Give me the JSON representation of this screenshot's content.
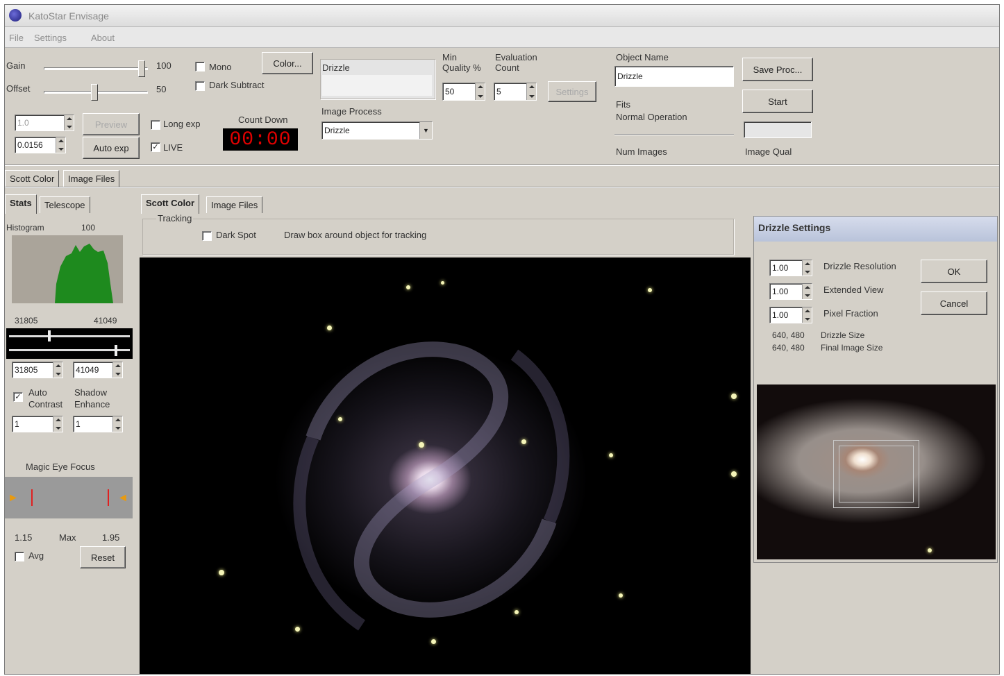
{
  "window": {
    "title": "KatoStar Envisage"
  },
  "menu": {
    "items": [
      "File",
      "Settings",
      "About"
    ]
  },
  "controls": {
    "gain_label": "Gain",
    "gain_value": "100",
    "offset_label": "Offset",
    "offset_value": "50",
    "mono_label": "Mono",
    "dark_subtract_label": "Dark Subtract",
    "color_button": "Color...",
    "exposure_value": "1.0",
    "exposure2_value": "0.0156",
    "preview_button": "Preview",
    "auto_exp_button": "Auto exp",
    "long_exp_label": "Long exp",
    "live_label": "LIVE",
    "countdown_label": "Count Down",
    "countdown_value": "00:00",
    "drizzle_label": "Drizzle",
    "image_process_label": "Image Process",
    "image_process_value": "Drizzle",
    "min_quality_label": "Min\nQuality %",
    "min_quality_value": "50",
    "evaluation_count_label": "Evaluation\nCount",
    "evaluation_count_value": "5",
    "disabled_button": "Settings",
    "object_name_label": "Object Name",
    "object_name_value": "Drizzle",
    "fits_label": "Fits",
    "status_text": "Normal Operation",
    "num_images_label": "Num Images",
    "image_qual_label": "Image Qual",
    "save_proc_button": "Save Proc...",
    "start_button": "Start"
  },
  "tabs_top": [
    "Scott Color",
    "Image Files"
  ],
  "tabs_left": [
    "Stats",
    "Telescope"
  ],
  "tabs_center": [
    "Scott Color",
    "Image Files"
  ],
  "histogram": {
    "label": "Histogram",
    "max_value": "100",
    "low": "31805",
    "high": "41049",
    "low_field": "31805",
    "high_field": "41049"
  },
  "auto_contrast": {
    "label": "Auto\nContrast",
    "shadow_label": "Shadow\nEnhance",
    "value1": "1",
    "value2": "1"
  },
  "magic_eye": {
    "label": "Magic Eye Focus",
    "value1": "1.15",
    "max_label": "Max",
    "value2": "1.95",
    "avg_label": "Avg",
    "reset_button": "Reset"
  },
  "tracking": {
    "label": "Tracking",
    "dark_spot_label": "Dark Spot",
    "hint": "Draw box around object for tracking"
  },
  "drizzle_settings": {
    "title": "Drizzle Settings",
    "resolution_value": "1.00",
    "resolution_label": "Drizzle Resolution",
    "extended_value": "1.00",
    "extended_label": "Extended View",
    "pixel_value": "1.00",
    "pixel_label": "Pixel Fraction",
    "drizzle_size_value": "640, 480",
    "drizzle_size_label": "Drizzle Size",
    "final_size_value": "640, 480",
    "final_size_label": "Final Image Size",
    "ok_button": "OK",
    "cancel_button": "Cancel"
  },
  "colors": {
    "histogram_fill": "#1e8a1e",
    "countdown_text": "#e00000",
    "face": "#d4d0c8"
  }
}
